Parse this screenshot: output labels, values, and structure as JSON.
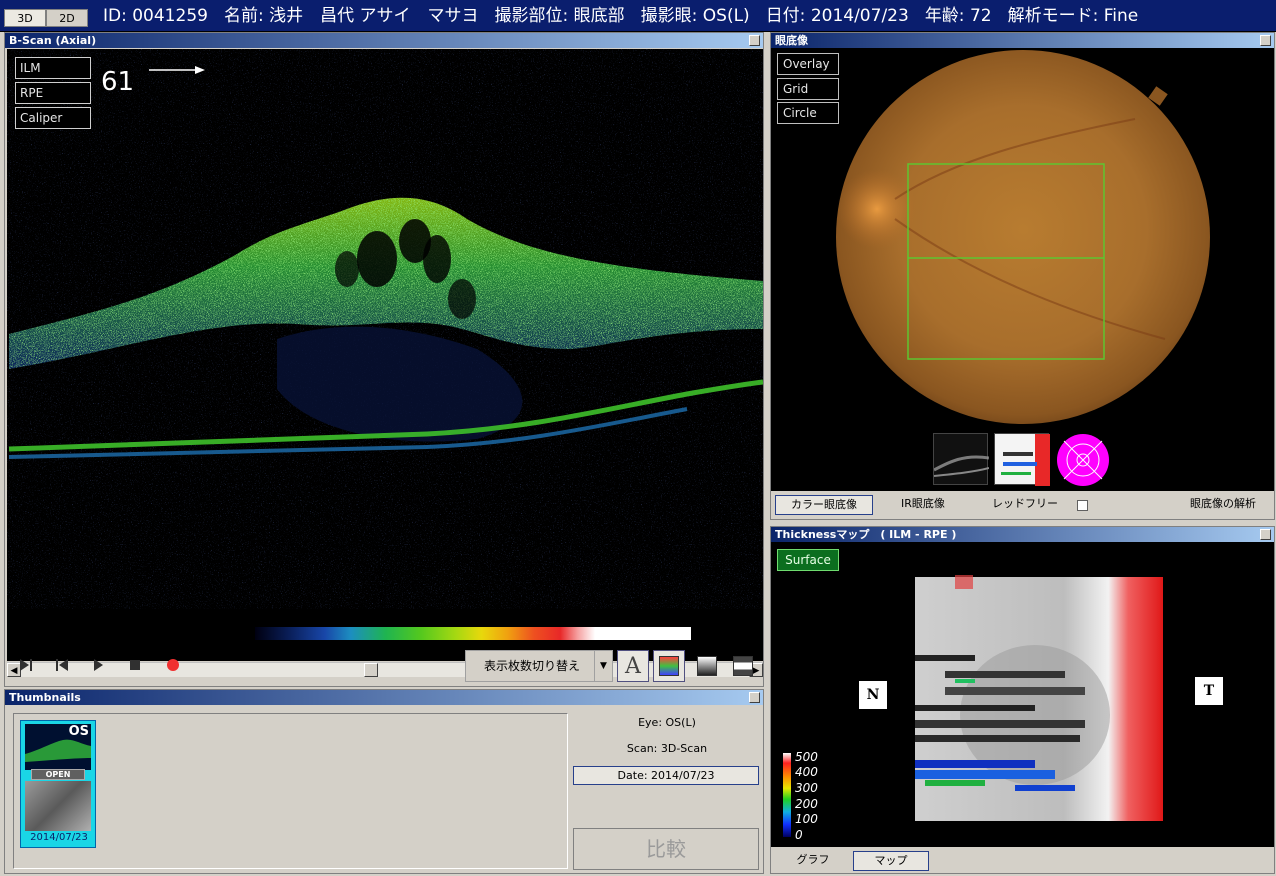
{
  "topbar": {
    "mode_3d": "3D",
    "mode_2d": "2D",
    "id": "ID: 0041259",
    "name": "名前: 浅井　昌代 アサイ　マサヨ",
    "region": "撮影部位: 眼底部",
    "eye": "撮影眼: OS(L)",
    "date": "日付: 2014/07/23",
    "age": "年齢: 72",
    "mode": "解析モード: Fine"
  },
  "bscan": {
    "title": "B-Scan (Axial)",
    "overlays": [
      "ILM",
      "RPE",
      "Caliper"
    ],
    "slice_number": "61",
    "display_select": "表示枚数切り替え",
    "tool_text": "A",
    "scroll_position": 0.48
  },
  "thumbnails": {
    "title": "Thumbnails",
    "card": {
      "eye_label": "OS",
      "open_label": "OPEN",
      "date": "2014/07/23"
    },
    "eye": "Eye: OS(L)",
    "scan": "Scan: 3D-Scan",
    "date": "Date: 2014/07/23",
    "compare": "比較"
  },
  "fundus": {
    "title": "眼底像",
    "buttons": [
      "Overlay",
      "Grid",
      "Circle"
    ],
    "tabs": [
      "カラー眼底像",
      "IR眼底像",
      "レッドフリー"
    ],
    "analysis": "眼底像の解析"
  },
  "thickness": {
    "title": "Thicknessマップ　( ILM - RPE )",
    "surface": "Surface",
    "nasal": "N",
    "temporal": "T",
    "legend": [
      "500",
      "400",
      "300",
      "200",
      "100",
      "0"
    ],
    "tabs": [
      "グラフ",
      "マップ"
    ]
  },
  "colors": {
    "titlebar": "#0a246a",
    "topbar": "#0a1e6e",
    "surface": "#0b6e1f",
    "magenta": "#ff00ff"
  }
}
